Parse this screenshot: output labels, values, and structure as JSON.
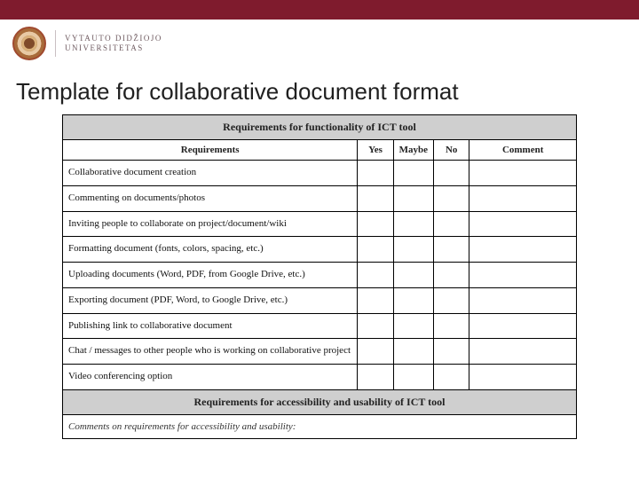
{
  "brand": {
    "line1": "VYTAUTO DIDŽIOJO",
    "line2": "UNIVERSITETAS"
  },
  "title": "Template for collaborative document format",
  "section1_header": "Requirements for functionality of ICT tool",
  "cols": {
    "req": "Requirements",
    "yes": "Yes",
    "maybe": "Maybe",
    "no": "No",
    "comment": "Comment"
  },
  "rows": [
    "Collaborative document creation",
    "Commenting on documents/photos",
    "Inviting people to collaborate on project/document/wiki",
    "Formatting document (fonts, colors, spacing, etc.)",
    "Uploading documents (Word, PDF, from Google Drive, etc.)",
    "Exporting document (PDF, Word, to Google Drive, etc.)",
    "Publishing link to collaborative document",
    "Chat / messages to other people who is working on collaborative project",
    "Video conferencing option"
  ],
  "section2_header": "Requirements for accessibility and usability of ICT tool",
  "comments_label": "Comments on requirements for accessibility and usability:"
}
